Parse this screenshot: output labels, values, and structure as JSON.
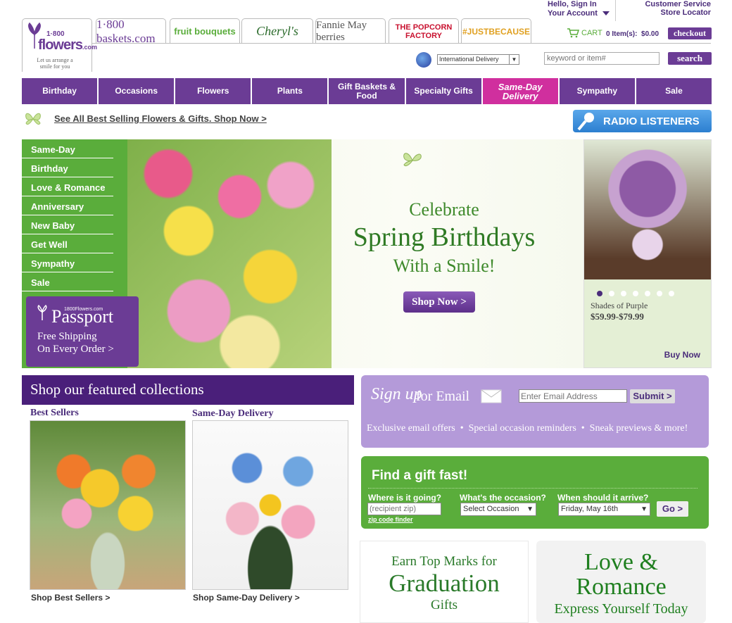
{
  "header": {
    "hello": "Hello, Sign In",
    "account": "Your Account",
    "customer_service": "Customer Service",
    "store_locator": "Store Locator",
    "cart_label": "CART",
    "cart_status": "0 Item(s):  $0.00",
    "checkout": "checkout",
    "intl_delivery": "International Delivery",
    "search_placeholder": "keyword or item#",
    "search_button": "search",
    "logo_line1": "1·800",
    "logo_line2": "flowers",
    "logo_dotcom": ".com",
    "logo_tagline": "Let us arrange a smile for you"
  },
  "brands": [
    {
      "label": "1·800 baskets.com"
    },
    {
      "label": "fruit bouquets"
    },
    {
      "label": "Cheryl's"
    },
    {
      "label": "Fannie May berries"
    },
    {
      "label": "THE POPCORN FACTORY"
    },
    {
      "label": "#JUSTBECAUSE"
    }
  ],
  "nav": [
    "Birthday",
    "Occasions",
    "Flowers",
    "Plants",
    "Gift Baskets & Food",
    "Specialty Gifts",
    "Same-Day Delivery",
    "Sympathy",
    "Sale"
  ],
  "promo_bar": {
    "text": "See All Best Selling Flowers & Gifts. Shop Now >",
    "radio": "RADIO LISTENERS"
  },
  "side_menu": [
    "Same-Day",
    "Birthday",
    "Love & Romance",
    "Anniversary",
    "New Baby",
    "Get Well",
    "Sympathy",
    "Sale"
  ],
  "passport": {
    "small": "1800Flowers.com",
    "title": "Passport",
    "line1": "Free Shipping",
    "line2": "On Every Order >"
  },
  "hero": {
    "line1": "Celebrate",
    "line2": "Spring Birthdays",
    "line3": "With a Smile!",
    "cta": "Shop Now >"
  },
  "featured_product": {
    "name": "Shades of Purple",
    "price": "$59.99-$79.99",
    "buy": "Buy Now",
    "slides": 7,
    "active_slide": 1
  },
  "collections": {
    "heading": "Shop our featured collections",
    "items": [
      {
        "title": "Best Sellers",
        "link": "Shop Best Sellers >"
      },
      {
        "title": "Same-Day Delivery",
        "link": "Shop Same-Day Delivery >"
      }
    ]
  },
  "email": {
    "signup": "Sign up",
    "for_email": "for Email",
    "placeholder": "Enter Email Address",
    "submit": "Submit >",
    "benefits": "Exclusive email offers  •  Special occasion reminders  •  Sneak previews & more!"
  },
  "gift_finder": {
    "title": "Find a gift fast!",
    "where_label": "Where is it going?",
    "zip_placeholder": "(recipient zip)",
    "zip_finder": "zip code finder",
    "occasion_label": "What's the occasion?",
    "occasion_value": "Select Occasion",
    "when_label": "When should it arrive?",
    "date_value": "Friday, May 16th",
    "go": "Go >"
  },
  "grad": {
    "line1": "Earn Top Marks for",
    "line2": "Graduation",
    "line3": "Gifts"
  },
  "love": {
    "line1": "Love &",
    "line2": "Romance",
    "line3": "Express Yourself Today"
  },
  "colors": {
    "purple": "#6b3c95",
    "dark_purple": "#4a1f7a",
    "green": "#5aad3b",
    "magenta": "#d02f9e",
    "radio_blue": "#3a8fd8"
  }
}
